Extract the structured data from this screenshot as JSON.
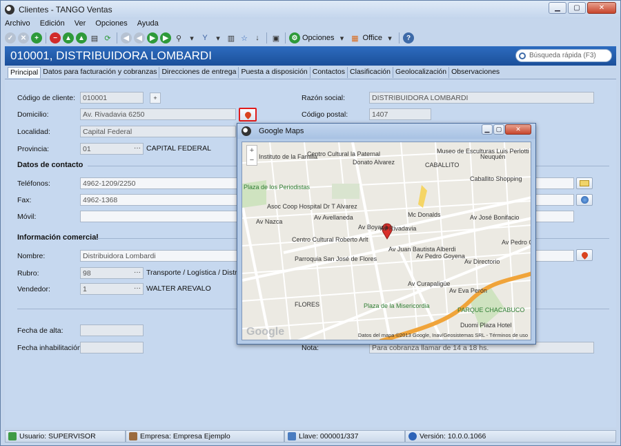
{
  "window": {
    "title": "Clientes - TANGO Ventas"
  },
  "menu": [
    "Archivo",
    "Edición",
    "Ver",
    "Opciones",
    "Ayuda"
  ],
  "toolbar": {
    "opciones_label": "Opciones",
    "office_label": "Office"
  },
  "header": {
    "title": "010001, DISTRIBUIDORA LOMBARDI",
    "search_placeholder": "Búsqueda rápida (F3)"
  },
  "tabs": [
    "Principal",
    "Datos para facturación y cobranzas",
    "Direcciones de entrega",
    "Puesta a disposición",
    "Contactos",
    "Clasificación",
    "Geolocalización",
    "Observaciones"
  ],
  "form": {
    "codigo_label": "Código de cliente:",
    "codigo_value": "010001",
    "razon_label": "Razón social:",
    "razon_value": "DISTRIBUIDORA LOMBARDI",
    "domicilio_label": "Domicilio:",
    "domicilio_value": "Av. Rivadavia 6250",
    "cp_label": "Código postal:",
    "cp_value": "1407",
    "localidad_label": "Localidad:",
    "localidad_value": "Capital Federal",
    "provincia_label": "Provincia:",
    "provincia_code": "01",
    "provincia_name": "CAPITAL FEDERAL",
    "contacto_section": "Datos de contacto",
    "telefonos_label": "Teléfonos:",
    "telefonos_value": "4962-1209/2250",
    "fax_label": "Fax:",
    "fax_value": "4962-1368",
    "movil_label": "Móvil:",
    "movil_value": "",
    "comercial_section": "Información comercial",
    "nombre_label": "Nombre:",
    "nombre_value": "Distribuidora Lombardi",
    "rubro_label": "Rubro:",
    "rubro_code": "98",
    "rubro_name": "Transporte / Logística / Distribu",
    "vendedor_label": "Vendedor:",
    "vendedor_code": "1",
    "vendedor_name": "WALTER AREVALO",
    "alta_label": "Fecha de alta:",
    "alta_value": "",
    "inhab_label": "Fecha inhabilitación:",
    "inhab_value": "",
    "nota_label": "Nota:",
    "nota_value": "Para cobranza llamar de 14 a 18 hs."
  },
  "map": {
    "title": "Google Maps",
    "attribution": "Datos del mapa ©2013 Google, Inav/Geosistemas SRL - Términos de uso",
    "labels": [
      {
        "t": "Instituto de la Familia",
        "cls": ""
      },
      {
        "t": "Centro Cultural la Paternal",
        "cls": ""
      },
      {
        "t": "Museo de Esculturas Luis Perlotti",
        "cls": ""
      },
      {
        "t": "CABALLITO",
        "cls": ""
      },
      {
        "t": "Neuquén",
        "cls": ""
      },
      {
        "t": "Caballito Shopping",
        "cls": ""
      },
      {
        "t": "Plaza de los Periodistas",
        "cls": "park"
      },
      {
        "t": "Asoc Coop Hospital Dr T Alvarez",
        "cls": ""
      },
      {
        "t": "Av Avellaneda",
        "cls": ""
      },
      {
        "t": "Mc Donalds",
        "cls": ""
      },
      {
        "t": "Av José Bonifacio",
        "cls": ""
      },
      {
        "t": "Centro Cultural Roberto Arlt",
        "cls": ""
      },
      {
        "t": "Parroquia San José de Flores",
        "cls": ""
      },
      {
        "t": "Av Rivadavia",
        "cls": ""
      },
      {
        "t": "Av Juan Bautista Alberdi",
        "cls": ""
      },
      {
        "t": "Av Pedro Goyena",
        "cls": ""
      },
      {
        "t": "Av Directorio",
        "cls": ""
      },
      {
        "t": "FLORES",
        "cls": ""
      },
      {
        "t": "Plaza de la Misericordia",
        "cls": "park"
      },
      {
        "t": "PARQUE CHACABUCO",
        "cls": "park"
      },
      {
        "t": "Duomi Plaza Hotel",
        "cls": ""
      },
      {
        "t": "Av Nazca",
        "cls": ""
      },
      {
        "t": "Av Boyacá",
        "cls": ""
      },
      {
        "t": "Av Curapaligüe",
        "cls": ""
      },
      {
        "t": "Av Eva Perón",
        "cls": ""
      },
      {
        "t": "Donato Alvarez",
        "cls": ""
      },
      {
        "t": "Av Pedro Go",
        "cls": ""
      }
    ]
  },
  "status": {
    "usuario": "Usuario: SUPERVISOR",
    "empresa": "Empresa: Empresa Ejemplo",
    "llave": "Llave: 000001/337",
    "version": "Versión: 10.0.0.1066"
  }
}
